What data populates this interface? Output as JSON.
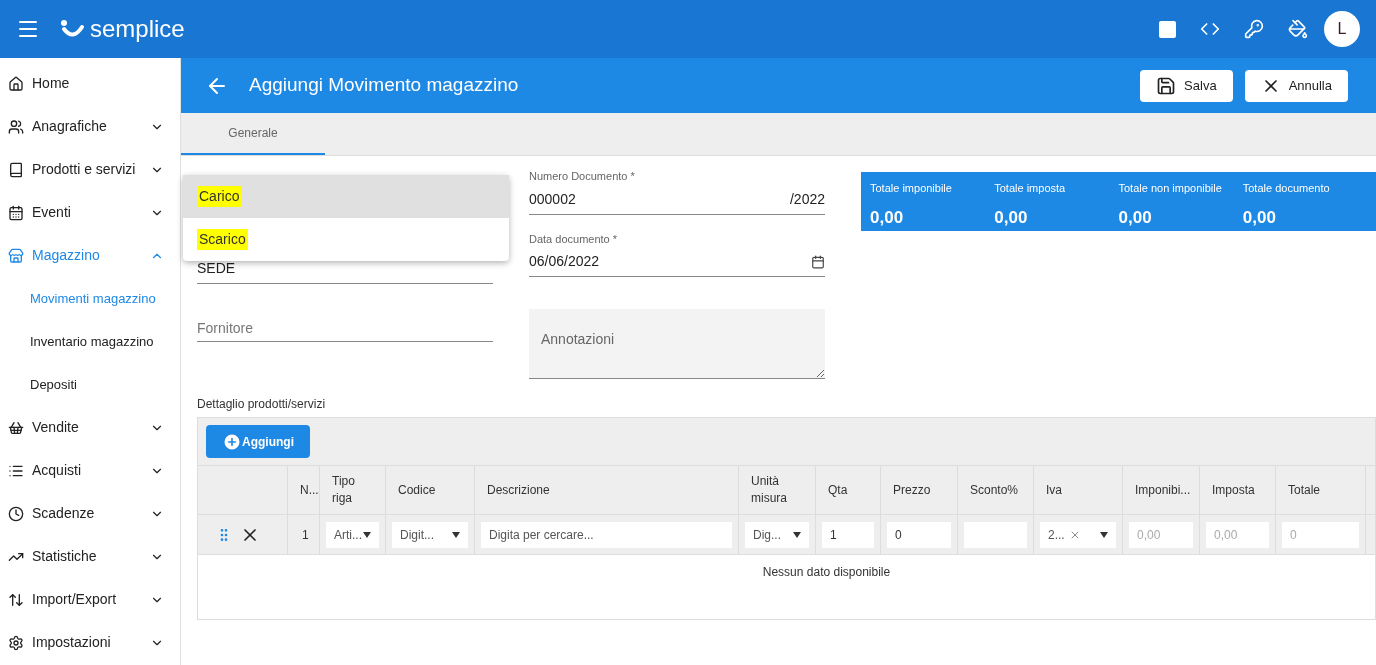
{
  "app": {
    "logo": "semplice",
    "avatar": "L"
  },
  "sidebar": {
    "items": [
      {
        "label": "Home",
        "expandable": false,
        "selected": false
      },
      {
        "label": "Anagrafiche",
        "expandable": true,
        "expanded": false,
        "selected": false
      },
      {
        "label": "Prodotti e servizi",
        "expandable": true,
        "expanded": false,
        "selected": false
      },
      {
        "label": "Eventi",
        "expandable": true,
        "expanded": false,
        "selected": false
      },
      {
        "label": "Magazzino",
        "expandable": true,
        "expanded": true,
        "selected": true,
        "children": [
          {
            "label": "Movimenti magazzino",
            "selected": true
          },
          {
            "label": "Inventario magazzino",
            "selected": false
          },
          {
            "label": "Depositi",
            "selected": false
          }
        ]
      },
      {
        "label": "Vendite",
        "expandable": true,
        "expanded": false,
        "selected": false
      },
      {
        "label": "Acquisti",
        "expandable": true,
        "expanded": false,
        "selected": false
      },
      {
        "label": "Scadenze",
        "expandable": true,
        "expanded": false,
        "selected": false
      },
      {
        "label": "Statistiche",
        "expandable": true,
        "expanded": false,
        "selected": false
      },
      {
        "label": "Import/Export",
        "expandable": true,
        "expanded": false,
        "selected": false
      },
      {
        "label": "Impostazioni",
        "expandable": true,
        "expanded": false,
        "selected": false
      }
    ]
  },
  "page": {
    "title": "Aggiungi Movimento magazzino",
    "buttons": [
      {
        "label": "Salva",
        "kind": "save"
      },
      {
        "label": "Annulla",
        "kind": "cancel"
      }
    ]
  },
  "tabs": [
    {
      "label": "Generale",
      "selected": true
    }
  ],
  "form": {
    "deposito": {
      "value": "SEDE"
    },
    "fornitore": {
      "placeholder": "Fornitore"
    },
    "numero": {
      "label": "Numero Documento *",
      "value": "000002",
      "suffix": "/2022"
    },
    "data": {
      "label": "Data documento *",
      "value": "06/06/2022"
    },
    "annotazioni": {
      "placeholder": "Annotazioni"
    }
  },
  "dropdown": {
    "options": [
      {
        "label": "Carico",
        "selected": true,
        "highlighted": true
      },
      {
        "label": "Scarico",
        "selected": false,
        "highlighted": true
      }
    ]
  },
  "totals": [
    {
      "label": "Totale imponibile",
      "value": "0,00"
    },
    {
      "label": "Totale imposta",
      "value": "0,00"
    },
    {
      "label": "Totale non imponibile",
      "value": "0,00"
    },
    {
      "label": "Totale documento",
      "value": "0,00"
    }
  ],
  "details": {
    "title": "Dettaglio prodotti/servizi",
    "add_button": "Aggiungi",
    "columns": [
      "",
      "N...",
      "Tipo riga",
      "Codice",
      "Descrizione",
      "Unità misura",
      "Qta",
      "Prezzo",
      "Sconto%",
      "Iva",
      "Imponibi...",
      "Imposta",
      "Totale"
    ],
    "rows": [
      {
        "cells": [
          {
            "kind": "actions"
          },
          {
            "kind": "text",
            "value": "1"
          },
          {
            "kind": "select",
            "value": "Arti..."
          },
          {
            "kind": "select",
            "value": "Digit..."
          },
          {
            "kind": "input",
            "placeholder": "Digita per cercare..."
          },
          {
            "kind": "select",
            "value": "Dig..."
          },
          {
            "kind": "input",
            "value": "1"
          },
          {
            "kind": "input",
            "value": "0"
          },
          {
            "kind": "input"
          },
          {
            "kind": "clearselect",
            "value": "2..."
          },
          {
            "kind": "input",
            "value": "0,00",
            "disabled": true
          },
          {
            "kind": "input",
            "value": "0,00",
            "disabled": true
          },
          {
            "kind": "input",
            "value": "0",
            "disabled": true
          }
        ]
      }
    ],
    "empty_text": "Nessun dato disponibile"
  }
}
